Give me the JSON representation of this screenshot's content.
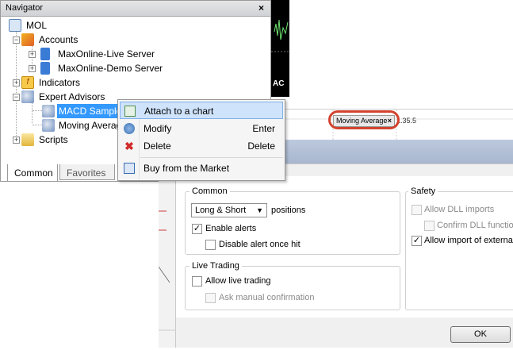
{
  "navigator": {
    "title": "Navigator",
    "close_label": "×",
    "tree": {
      "root": "MOL",
      "accounts": "Accounts",
      "server_live": "MaxOnline-Live Server",
      "server_demo": "MaxOnline-Demo Server",
      "indicators": "Indicators",
      "expert_advisors": "Expert Advisors",
      "macd_sample": "MACD Sample",
      "moving_average": "Moving Averag",
      "scripts": "Scripts"
    },
    "tabs": [
      "Common",
      "Favorites"
    ]
  },
  "chart": {
    "corner_label": "AC",
    "tab_label": "Moving Average",
    "tab_close": "×",
    "price_label": "1.35.5"
  },
  "context_menu": {
    "items": [
      {
        "label": "Attach to a chart",
        "shortcut": ""
      },
      {
        "label": "Modify",
        "shortcut": "Enter"
      },
      {
        "label": "Delete",
        "shortcut": "Delete"
      },
      {
        "label": "Buy from the Market",
        "shortcut": ""
      }
    ]
  },
  "dialog": {
    "common": {
      "title": "Common",
      "positions_value": "Long & Short",
      "positions_label": "positions",
      "enable_alerts": "Enable alerts",
      "disable_alert_once": "Disable alert once hit"
    },
    "live_trading": {
      "title": "Live Trading",
      "allow_live": "Allow live trading",
      "ask_manual": "Ask manual confirmation"
    },
    "safety": {
      "title": "Safety",
      "allow_dll": "Allow DLL imports",
      "confirm_dll": "Confirm DLL function",
      "allow_external": "Allow import of external"
    },
    "ok_label": "OK"
  },
  "colors": {
    "selection": "#3399ff",
    "highlight": "#cfe3fb",
    "annotation_ring": "#d2422e"
  }
}
